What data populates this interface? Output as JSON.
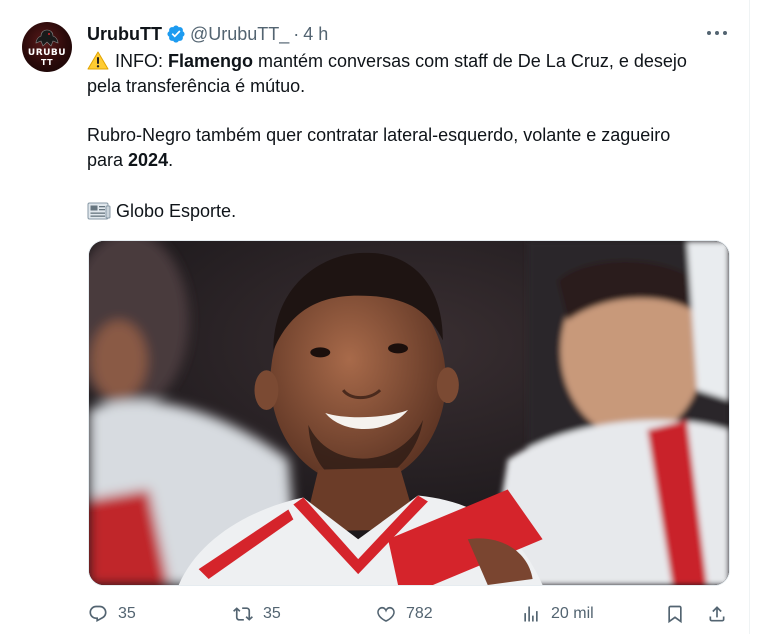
{
  "account": {
    "display_name": "UrubuTT",
    "handle": "@UrubuTT_",
    "separator": "·",
    "time": "4 h",
    "avatar_logo_line1": "URUBU",
    "avatar_logo_line2": "TT"
  },
  "content": {
    "line1_prefix": "INFO: ",
    "line1_bold": "Flamengo",
    "line1_rest": " mantém conversas com staff de De La Cruz, e desejo",
    "line2": "pela transferência é mútuo.",
    "line3": "Rubro-Negro também quer contratar lateral-esquerdo, volante e zagueiro",
    "line4_prefix": "para ",
    "line4_bold": "2024",
    "line4_suffix": ".",
    "line5": "Globo Esporte."
  },
  "icons": {
    "warning": "warning-emoji-icon",
    "newspaper": "newspaper-emoji-icon",
    "verified": "verified-badge-icon",
    "more": "more-options-icon"
  },
  "metrics": {
    "replies": "35",
    "retweets": "35",
    "likes": "782",
    "views": "20 mil"
  },
  "colors": {
    "text": "#0f1419",
    "secondary": "#536471",
    "verified": "#1d9bf0",
    "jersey_red": "#d5242b"
  }
}
